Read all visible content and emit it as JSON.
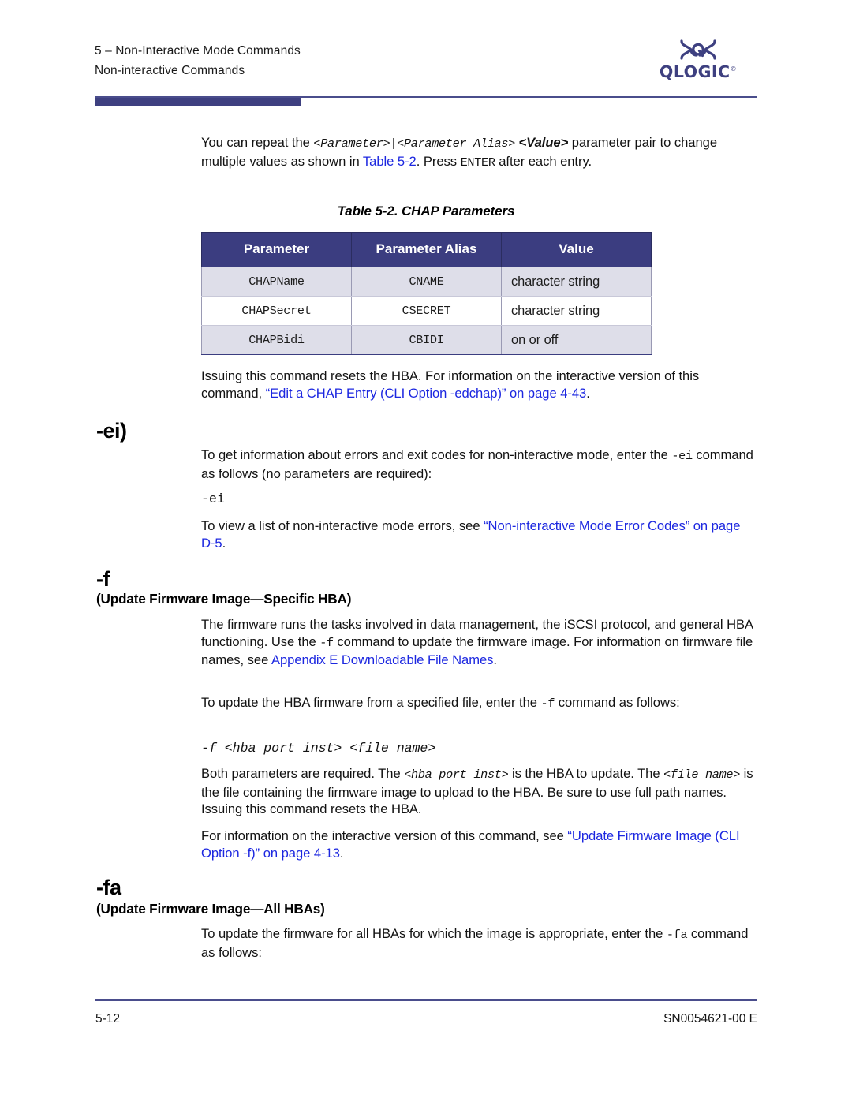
{
  "header": {
    "chapter": "5 – Non-Interactive Mode Commands",
    "section": "Non-interactive Commands",
    "logo_word": "QLOGIC",
    "logo_tm": "®"
  },
  "intro": {
    "t1": "You can repeat the ",
    "m1": "<Parameter>|<Parameter Alias>",
    "sp1": " ",
    "m2": "<Value>",
    "t2": " parameter pair to change multiple values as shown in ",
    "link1": "Table 5-2",
    "t3": ". Press ",
    "m3": "ENTER",
    "t4": " after each entry."
  },
  "table": {
    "caption": "Table 5-2. CHAP Parameters",
    "headers": [
      "Parameter",
      "Parameter Alias",
      "Value"
    ],
    "rows": [
      {
        "parameter": "CHAPName",
        "alias": "CNAME",
        "value": "character string"
      },
      {
        "parameter": "CHAPSecret",
        "alias": "CSECRET",
        "value": "character string"
      },
      {
        "parameter": "CHAPBidi",
        "alias": "CBIDI",
        "value": "on or off"
      }
    ]
  },
  "after_table": {
    "t1": "Issuing this command resets the HBA. For information on the interactive version of this command, ",
    "link1": "“Edit a CHAP Entry (CLI Option -edchap)” on page 4-43",
    "t2": "."
  },
  "ei": {
    "heading": "-ei)",
    "p1_a": "To get information about errors and exit codes for non-interactive mode, enter the ",
    "p1_m": "-ei",
    "p1_b": " command as follows (no parameters are required):",
    "code": "-ei",
    "p2_a": "To view a list of non-interactive mode errors, see ",
    "p2_link": "“Non-interactive Mode Error Codes” on page D-5",
    "p2_b": "."
  },
  "f": {
    "heading": "-f",
    "subheading": "(Update Firmware Image—Specific HBA)",
    "p1_a": "The firmware runs the tasks involved in data management, the iSCSI protocol, and general HBA functioning. Use the ",
    "p1_m": "-f",
    "p1_b": " command to update the firmware image. For information on firmware file names, see ",
    "p1_link": "Appendix E Downloadable File Names",
    "p1_c": ".",
    "p2_a": "To update the HBA firmware from a specified file, enter the ",
    "p2_m": "-f",
    "p2_b": " command as follows:",
    "code": "-f <hba_port_inst> <file name>",
    "p3_a": "Both parameters are required. The ",
    "p3_m1": "<hba_port_inst>",
    "p3_b": " is the HBA to update. The ",
    "p3_m2": "<file name>",
    "p3_c": " is the file containing the firmware image to upload to the HBA. Be sure to use full path names. Issuing this command resets the HBA.",
    "p4_a": "For information on the interactive version of this command, see ",
    "p4_link": "“Update Firmware Image (CLI Option -f)” on page 4-13",
    "p4_b": "."
  },
  "fa": {
    "heading": "-fa",
    "subheading": "(Update Firmware Image—All HBAs)",
    "p1_a": "To update the firmware for all HBAs for which the image is appropriate, enter the ",
    "p1_m": "-fa",
    "p1_b": " command as follows:"
  },
  "footer": {
    "page_number": "5-12",
    "doc_number": "SN0054621-00  E"
  },
  "colors": {
    "navy": "#3b3d80",
    "rule": "#4a4d8c",
    "link": "#1c27e0",
    "row_shade": "#dedee9"
  }
}
